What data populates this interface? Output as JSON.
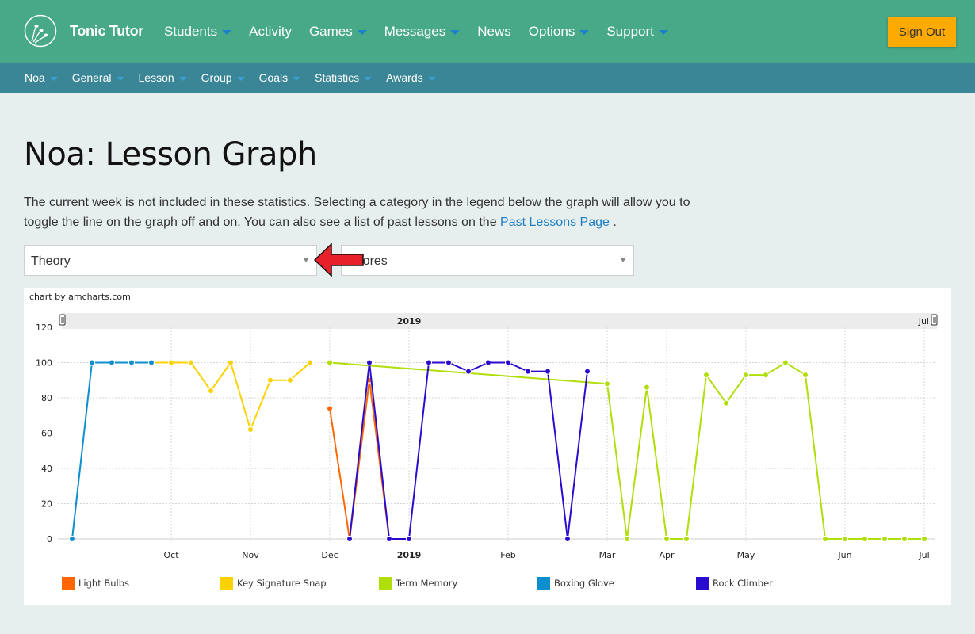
{
  "header": {
    "brand": "Tonic Tutor",
    "nav": [
      {
        "label": "Students",
        "dropdown": true
      },
      {
        "label": "Activity",
        "dropdown": false
      },
      {
        "label": "Games",
        "dropdown": true
      },
      {
        "label": "Messages",
        "dropdown": true
      },
      {
        "label": "News",
        "dropdown": false
      },
      {
        "label": "Options",
        "dropdown": true
      },
      {
        "label": "Support",
        "dropdown": true
      }
    ],
    "sign_out": "Sign Out"
  },
  "subnav": [
    {
      "label": "Noa"
    },
    {
      "label": "General"
    },
    {
      "label": "Lesson"
    },
    {
      "label": "Group"
    },
    {
      "label": "Goals"
    },
    {
      "label": "Statistics"
    },
    {
      "label": "Awards"
    }
  ],
  "page": {
    "title": "Noa: Lesson Graph",
    "intro_text": "The current week is not included in these statistics. Selecting a category in the legend below the graph will allow you to toggle the line on the graph off and on. You can also see a list of past lessons on the ",
    "link_text": "Past Lessons Page",
    "intro_end": " .",
    "category_select": "Theory",
    "metric_select": "Scores"
  },
  "chart_data": {
    "type": "line",
    "credit": "chart by amcharts.com",
    "scrollbar_label": "2019",
    "scrollbar_end_label": "Jul",
    "ylim": [
      0,
      120
    ],
    "yticks": [
      0,
      20,
      40,
      60,
      80,
      100,
      120
    ],
    "grid": true,
    "legend_position": "bottom",
    "x_unit": "week index (weekly points)",
    "xlim": [
      0,
      43
    ],
    "xticks": [
      {
        "week": 5,
        "label": "Oct",
        "bold": false
      },
      {
        "week": 9,
        "label": "Nov",
        "bold": false
      },
      {
        "week": 13,
        "label": "Dec",
        "bold": false
      },
      {
        "week": 17,
        "label": "2019",
        "bold": true
      },
      {
        "week": 22,
        "label": "Feb",
        "bold": false
      },
      {
        "week": 27,
        "label": "Mar",
        "bold": false
      },
      {
        "week": 30,
        "label": "Apr",
        "bold": false
      },
      {
        "week": 34,
        "label": "May",
        "bold": false
      },
      {
        "week": 39,
        "label": "Jun",
        "bold": false
      },
      {
        "week": 43,
        "label": "Jul",
        "bold": false
      }
    ],
    "series": [
      {
        "name": "Light Bulbs",
        "color": "#ff6600",
        "points": [
          [
            13,
            74
          ],
          [
            14,
            0
          ],
          [
            15,
            90
          ],
          [
            16,
            0
          ]
        ]
      },
      {
        "name": "Key Signature Snap",
        "color": "#fcd202",
        "points": [
          [
            4,
            100
          ],
          [
            5,
            100
          ],
          [
            6,
            100
          ],
          [
            7,
            84
          ],
          [
            8,
            100
          ],
          [
            9,
            62
          ],
          [
            10,
            90
          ],
          [
            11,
            90
          ],
          [
            12,
            100
          ]
        ]
      },
      {
        "name": "Term Memory",
        "color": "#b0de09",
        "points": [
          [
            13,
            100
          ],
          [
            27,
            88
          ],
          [
            28,
            0
          ],
          [
            29,
            86
          ],
          [
            30,
            0
          ],
          [
            31,
            0
          ],
          [
            32,
            93
          ],
          [
            33,
            77
          ],
          [
            34,
            93
          ],
          [
            35,
            93
          ],
          [
            36,
            100
          ],
          [
            37,
            93
          ],
          [
            38,
            0
          ],
          [
            39,
            0
          ],
          [
            40,
            0
          ],
          [
            41,
            0
          ],
          [
            42,
            0
          ],
          [
            43,
            0
          ]
        ]
      },
      {
        "name": "Boxing Glove",
        "color": "#0d8ecf",
        "points": [
          [
            0,
            0
          ],
          [
            1,
            100
          ],
          [
            2,
            100
          ],
          [
            3,
            100
          ],
          [
            4,
            100
          ]
        ]
      },
      {
        "name": "Rock Climber",
        "color": "#2a0cd0",
        "points": [
          [
            14,
            0
          ],
          [
            15,
            100
          ],
          [
            16,
            0
          ],
          [
            17,
            0
          ],
          [
            18,
            100
          ],
          [
            19,
            100
          ],
          [
            20,
            95
          ],
          [
            21,
            100
          ],
          [
            22,
            100
          ],
          [
            23,
            95
          ],
          [
            24,
            95
          ],
          [
            25,
            0
          ],
          [
            26,
            95
          ]
        ]
      }
    ]
  }
}
